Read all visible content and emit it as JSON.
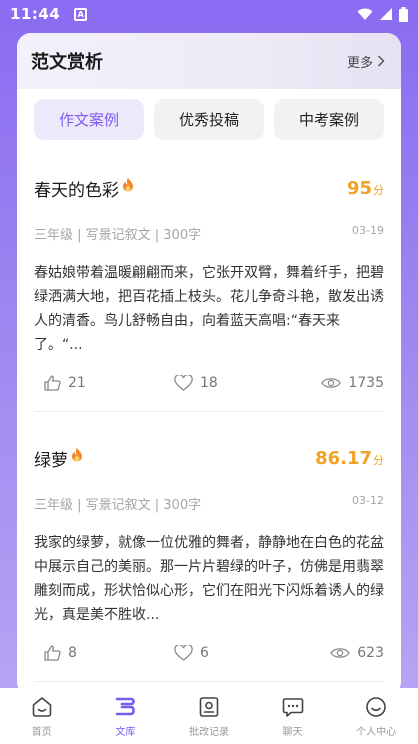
{
  "status": {
    "time": "11:44",
    "notif": "A"
  },
  "section": {
    "title": "范文赏析",
    "more": "更多"
  },
  "tabs": [
    {
      "label": "作文案例",
      "active": true
    },
    {
      "label": "优秀投稿",
      "active": false
    },
    {
      "label": "中考案例",
      "active": false
    }
  ],
  "articles": [
    {
      "title": "春天的色彩",
      "score": "95",
      "score_unit": "分",
      "meta": "三年级 | 写景记叙文 | 300字",
      "date": "03-19",
      "excerpt": "春姑娘带着温暖翩翩而来，它张开双臂，舞着纤手，把碧绿洒满大地，把百花插上枝头。花儿争奇斗艳，散发出诱人的清香。鸟儿舒畅自由，向着蓝天高唱:“春天来了。“...",
      "likes": "21",
      "favorites": "18",
      "views": "1735"
    },
    {
      "title": "绿萝",
      "score": "86.17",
      "score_unit": "分",
      "meta": "三年级 | 写景记叙文 | 300字",
      "date": "03-12",
      "excerpt": "我家的绿萝，就像一位优雅的舞者，静静地在白色的花盆中展示自己的美丽。那一片片碧绿的叶子，仿佛是用翡翠雕刻而成，形状恰似心形，它们在阳光下闪烁着诱人的绿光，真是美不胜收...",
      "likes": "8",
      "favorites": "6",
      "views": "623"
    }
  ],
  "nav": [
    {
      "label": "首页",
      "icon": "home-icon",
      "active": false
    },
    {
      "label": "文库",
      "icon": "library-icon",
      "active": true
    },
    {
      "label": "批改记录",
      "icon": "record-icon",
      "active": false
    },
    {
      "label": "聊天",
      "icon": "chat-icon",
      "active": false
    },
    {
      "label": "个人中心",
      "icon": "profile-icon",
      "active": false
    }
  ],
  "colors": {
    "accent": "#7a5cf0",
    "score": "#f0a224",
    "header_bg": "#8a6bf2"
  }
}
